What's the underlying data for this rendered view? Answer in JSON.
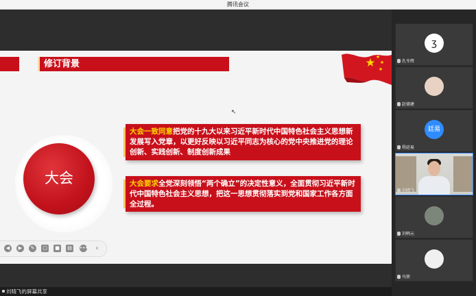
{
  "window": {
    "title": "腾讯会议"
  },
  "slide": {
    "section_title": "修订背景",
    "circle_label": "大会",
    "box1": {
      "lead": "大会一致同意",
      "text": "把党的十九大以来习近平新时代中国特色社会主义思想新发展写入党章，以更好反映以习近平同志为核心的党中央推进党的理论创新、实践创新、制度创新成果"
    },
    "box2": {
      "lead": "大会要求",
      "text": "全党深刻领悟“两个确立”的决定性意义，全面贯彻习近平新时代中国特色社会主义思想，把这一思想贯彻落实到党和国家工作各方面全过程。"
    }
  },
  "toolbar": {
    "icons": [
      "prev-icon",
      "next-icon",
      "pen-icon",
      "fullscreen-icon",
      "camera-icon",
      "comment-icon",
      "more-icon",
      "collapse-icon"
    ]
  },
  "status": {
    "share_label": "刘晴飞的屏幕共享"
  },
  "participants": [
    {
      "name": "孔令辉",
      "avatar": "logo"
    },
    {
      "name": "赵德建",
      "avatar": "photo"
    },
    {
      "name": "杨廷易",
      "avatar": "text",
      "avatar_text": "廷易"
    },
    {
      "name": "刘晴飞",
      "avatar": "video"
    },
    {
      "name": "刘韩元",
      "avatar": "gray"
    },
    {
      "name": "马荣",
      "avatar": "photo-white"
    }
  ],
  "colors": {
    "accent_red": "#c8101b",
    "highlight_yellow": "#ffd400",
    "active_border": "#3b8cff"
  }
}
